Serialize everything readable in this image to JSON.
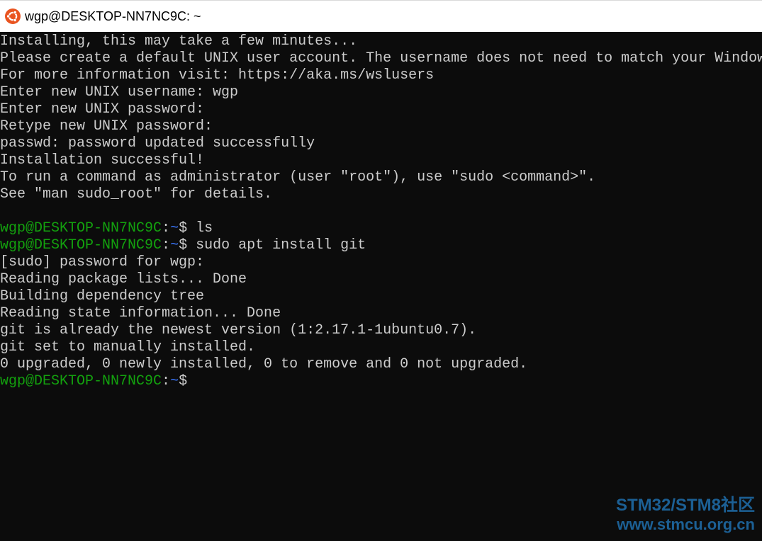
{
  "window": {
    "title": "wgp@DESKTOP-NN7NC9C: ~",
    "icon": "ubuntu-icon",
    "colors": {
      "background": "#0c0c0c",
      "text": "#cccccc",
      "prompt_user": "#13a10e",
      "prompt_path": "#3b78ff",
      "icon": "#e95420"
    }
  },
  "terminal": {
    "lines": [
      {
        "type": "text",
        "text": "Installing, this may take a few minutes..."
      },
      {
        "type": "text",
        "text": "Please create a default UNIX user account. The username does not need to match your Windows username."
      },
      {
        "type": "text",
        "text": "For more information visit: https://aka.ms/wslusers"
      },
      {
        "type": "text",
        "text": "Enter new UNIX username: wgp"
      },
      {
        "type": "text",
        "text": "Enter new UNIX password:"
      },
      {
        "type": "text",
        "text": "Retype new UNIX password:"
      },
      {
        "type": "text",
        "text": "passwd: password updated successfully"
      },
      {
        "type": "text",
        "text": "Installation successful!"
      },
      {
        "type": "text",
        "text": "To run a command as administrator (user \"root\"), use \"sudo <command>\"."
      },
      {
        "type": "text",
        "text": "See \"man sudo_root\" for details."
      },
      {
        "type": "text",
        "text": ""
      },
      {
        "type": "prompt",
        "user": "wgp@DESKTOP-NN7NC9C",
        "path": "~",
        "command": " ls"
      },
      {
        "type": "prompt",
        "user": "wgp@DESKTOP-NN7NC9C",
        "path": "~",
        "command": " sudo apt install git"
      },
      {
        "type": "text",
        "text": "[sudo] password for wgp:"
      },
      {
        "type": "text",
        "text": "Reading package lists... Done"
      },
      {
        "type": "text",
        "text": "Building dependency tree"
      },
      {
        "type": "text",
        "text": "Reading state information... Done"
      },
      {
        "type": "text",
        "text": "git is already the newest version (1:2.17.1-1ubuntu0.7)."
      },
      {
        "type": "text",
        "text": "git set to manually installed."
      },
      {
        "type": "text",
        "text": "0 upgraded, 0 newly installed, 0 to remove and 0 not upgraded."
      },
      {
        "type": "prompt",
        "user": "wgp@DESKTOP-NN7NC9C",
        "path": "~",
        "command": ""
      }
    ]
  },
  "watermark": {
    "line1": "STM32/STM8社区",
    "line2": "www.stmcu.org.cn",
    "color": "#1f6fae"
  }
}
